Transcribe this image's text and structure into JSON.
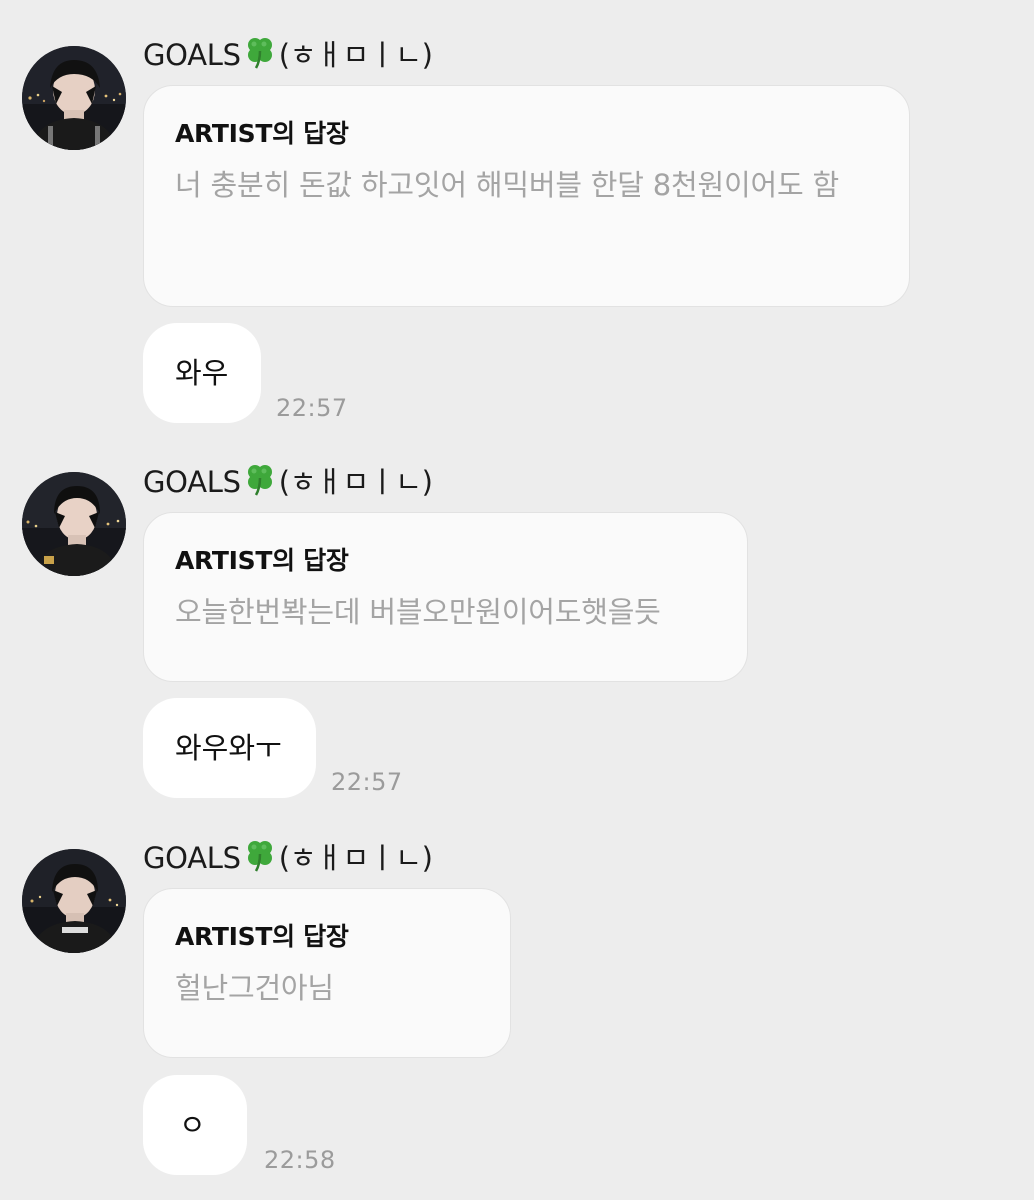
{
  "messages": [
    {
      "sender_name": "GOALS",
      "sender_suffix": "(ㅎㅐㅁㅣㄴ)",
      "reply_title": "ARTIST의 답장",
      "reply_text": "너 충분히 돈값 하고잇어 해믹버블 한달 8천원이어도 함",
      "message_text": "와우",
      "time": "22:57"
    },
    {
      "sender_name": "GOALS",
      "sender_suffix": "(ㅎㅐㅁㅣㄴ)",
      "reply_title": "ARTIST의 답장",
      "reply_text": "오늘한번봑는데 버블오만원이어도햇을듯",
      "message_text": "와우와ㅜ",
      "time": "22:57"
    },
    {
      "sender_name": "GOALS",
      "sender_suffix": "(ㅎㅐㅁㅣㄴ)",
      "reply_title": "ARTIST의 답장",
      "reply_text": "헐난그건아님",
      "message_text": "ㅇ",
      "time": "22:58"
    }
  ],
  "icons": {
    "sender_emoji": "four-leaf-clover-icon"
  },
  "colors": {
    "background": "#ededed",
    "reply_card": "#fafafa",
    "reply_text": "#a4a4a4",
    "timestamp": "#9b9b9b",
    "clover": "#3fa83b"
  }
}
